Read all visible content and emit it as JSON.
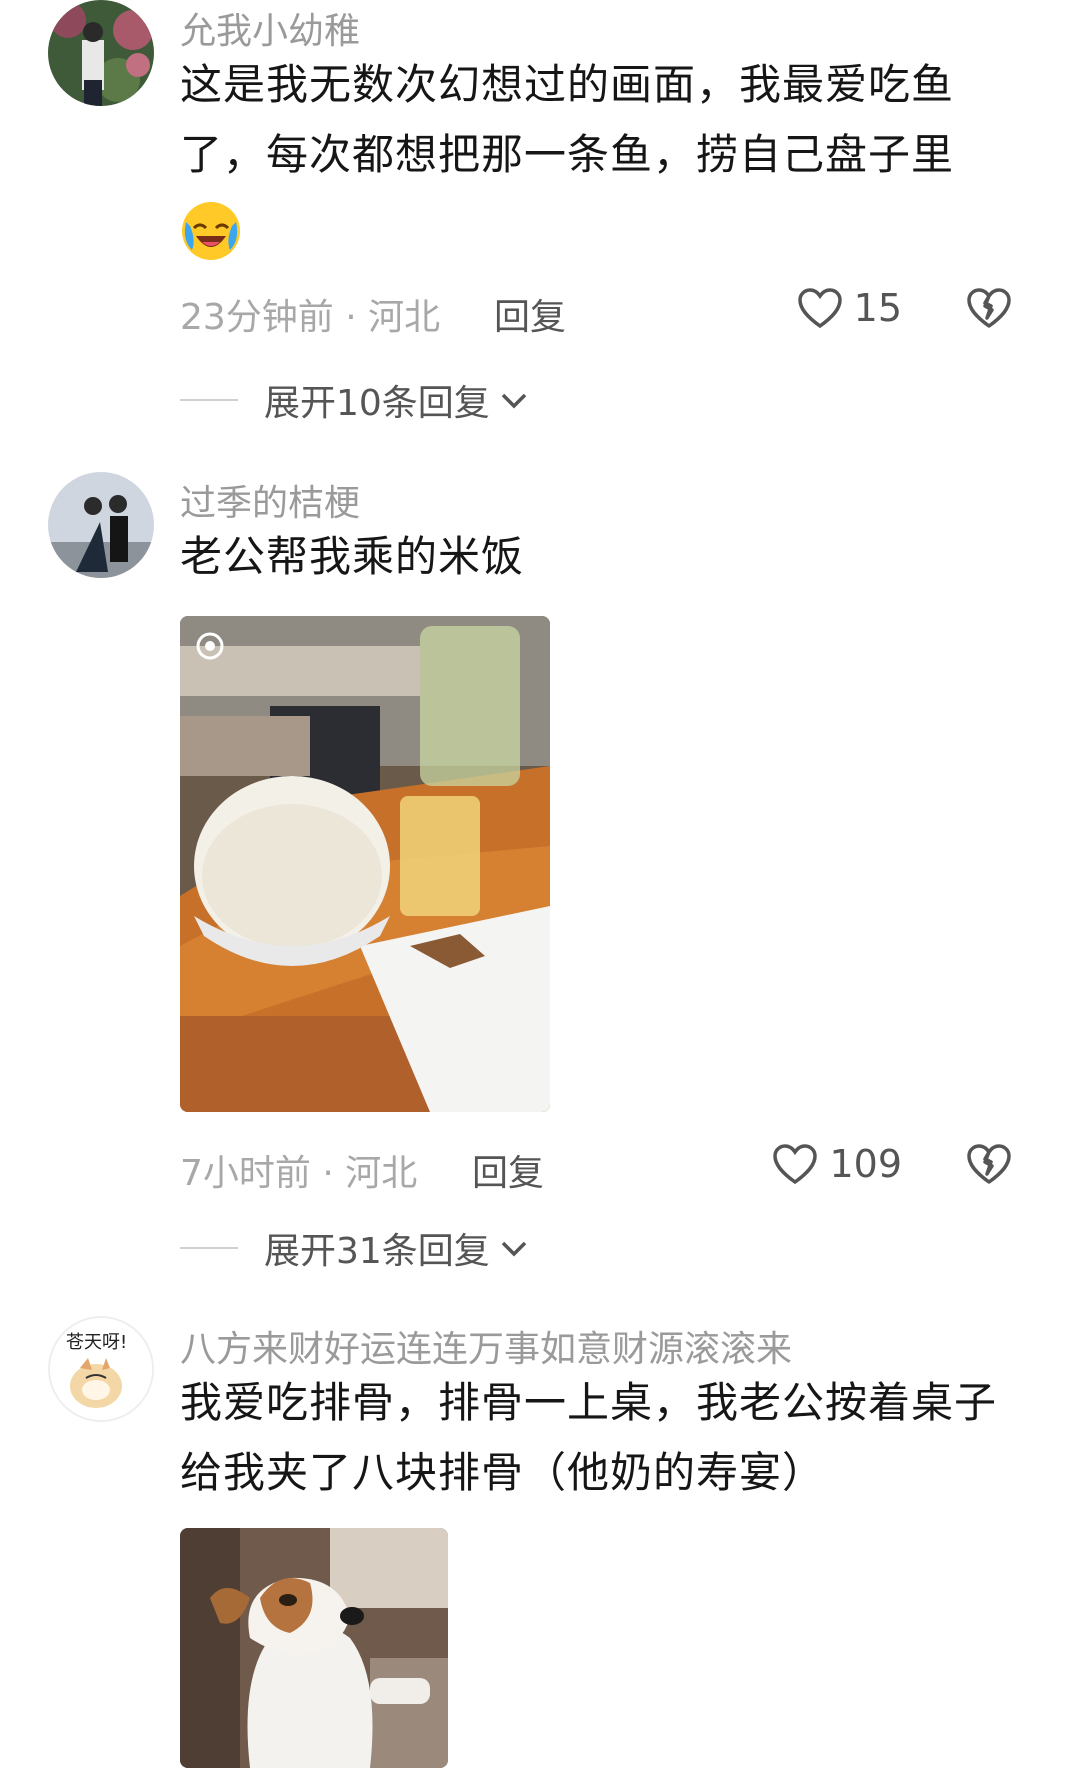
{
  "comments": [
    {
      "username": "允我小幼稚",
      "text": "这是我无数次幻想过的画面，我最爱吃鱼了，每次都想把那一条鱼，捞自己盘子里",
      "emoji": "crying-laughing-emoji",
      "time_location": "23分钟前 · 河北",
      "reply_label": "回复",
      "likes": "15",
      "expand_label": "展开10条回复"
    },
    {
      "username": "过季的桔梗",
      "text": "老公帮我乘的米饭",
      "image": "rice-bowl-photo",
      "time_location": "7小时前 · 河北",
      "reply_label": "回复",
      "likes": "109",
      "expand_label": "展开31条回复"
    },
    {
      "username": "八方来财好运连连万事如意财源滚滚来",
      "avatar_text": "苍天呀!",
      "text": "我爱吃排骨，排骨一上桌，我老公按着桌子给我夹了八块排骨（他奶的寿宴）",
      "image": "dog-meme-photo"
    }
  ],
  "colors": {
    "meta": "#a8a8a8",
    "username": "#9a9a9a",
    "text": "#161616"
  }
}
